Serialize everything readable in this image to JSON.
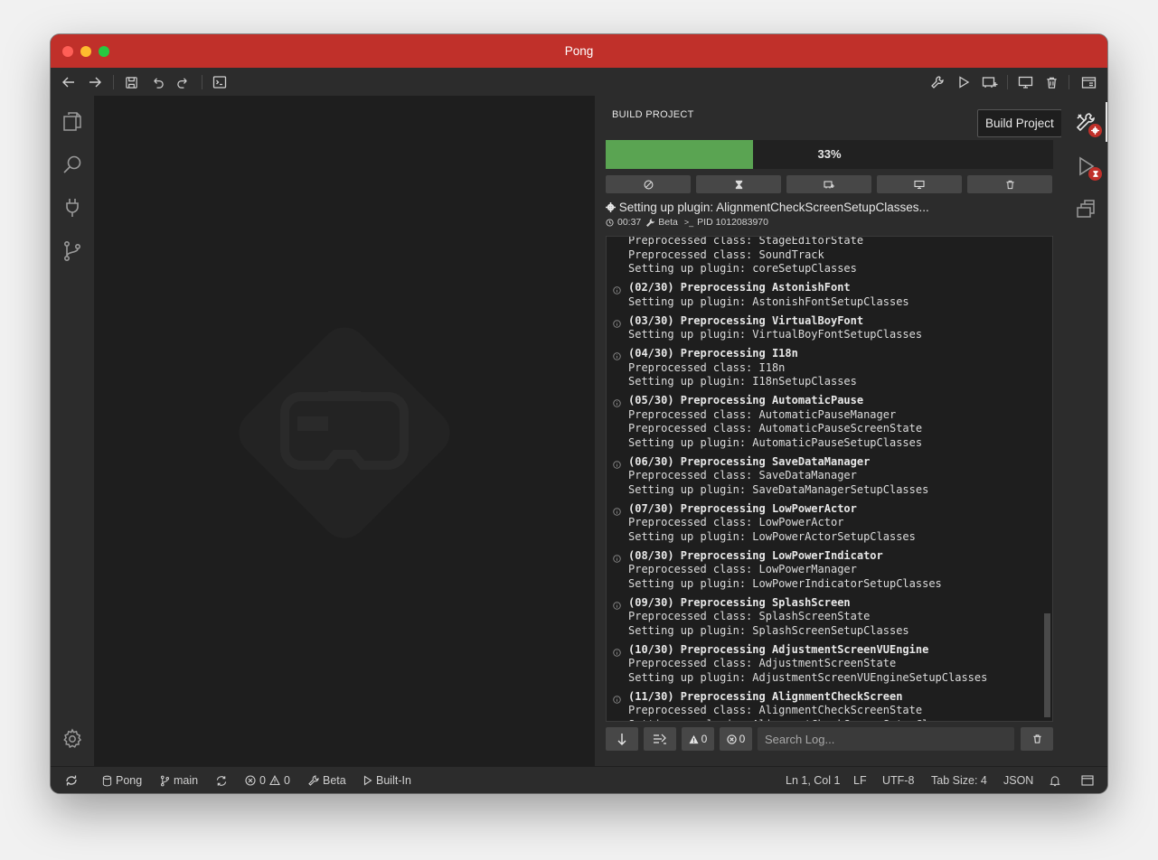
{
  "window": {
    "title": "Pong"
  },
  "panel": {
    "title": "BUILD PROJECT",
    "progress_percent": 33,
    "progress_label": "33%",
    "status_text": "Setting up plugin: AlignmentCheckScreenSetupClasses...",
    "elapsed": "00:37",
    "mode": "Beta",
    "pid": "PID 1012083970"
  },
  "tooltip": "Build Project",
  "log": [
    {
      "text": "Preprocessed class: StageEditorState",
      "bold": false,
      "icon": false
    },
    {
      "text": "Preprocessed class: SoundTrack",
      "bold": false,
      "icon": false
    },
    {
      "text": "Setting up plugin: coreSetupClasses",
      "bold": false,
      "icon": false
    },
    {
      "text": "(02/30) Preprocessing AstonishFont",
      "bold": true,
      "icon": true
    },
    {
      "text": "Setting up plugin: AstonishFontSetupClasses",
      "bold": false,
      "icon": false
    },
    {
      "text": "(03/30) Preprocessing VirtualBoyFont",
      "bold": true,
      "icon": true
    },
    {
      "text": "Setting up plugin: VirtualBoyFontSetupClasses",
      "bold": false,
      "icon": false
    },
    {
      "text": "(04/30) Preprocessing I18n",
      "bold": true,
      "icon": true
    },
    {
      "text": "Preprocessed class: I18n",
      "bold": false,
      "icon": false
    },
    {
      "text": "Setting up plugin: I18nSetupClasses",
      "bold": false,
      "icon": false
    },
    {
      "text": "(05/30) Preprocessing AutomaticPause",
      "bold": true,
      "icon": true
    },
    {
      "text": "Preprocessed class: AutomaticPauseManager",
      "bold": false,
      "icon": false
    },
    {
      "text": "Preprocessed class: AutomaticPauseScreenState",
      "bold": false,
      "icon": false
    },
    {
      "text": "Setting up plugin: AutomaticPauseSetupClasses",
      "bold": false,
      "icon": false
    },
    {
      "text": "(06/30) Preprocessing SaveDataManager",
      "bold": true,
      "icon": true
    },
    {
      "text": "Preprocessed class: SaveDataManager",
      "bold": false,
      "icon": false
    },
    {
      "text": "Setting up plugin: SaveDataManagerSetupClasses",
      "bold": false,
      "icon": false
    },
    {
      "text": "(07/30) Preprocessing LowPowerActor",
      "bold": true,
      "icon": true
    },
    {
      "text": "Preprocessed class: LowPowerActor",
      "bold": false,
      "icon": false
    },
    {
      "text": "Setting up plugin: LowPowerActorSetupClasses",
      "bold": false,
      "icon": false
    },
    {
      "text": "(08/30) Preprocessing LowPowerIndicator",
      "bold": true,
      "icon": true
    },
    {
      "text": "Preprocessed class: LowPowerManager",
      "bold": false,
      "icon": false
    },
    {
      "text": "Setting up plugin: LowPowerIndicatorSetupClasses",
      "bold": false,
      "icon": false
    },
    {
      "text": "(09/30) Preprocessing SplashScreen",
      "bold": true,
      "icon": true
    },
    {
      "text": "Preprocessed class: SplashScreenState",
      "bold": false,
      "icon": false
    },
    {
      "text": "Setting up plugin: SplashScreenSetupClasses",
      "bold": false,
      "icon": false
    },
    {
      "text": "(10/30) Preprocessing AdjustmentScreenVUEngine",
      "bold": true,
      "icon": true
    },
    {
      "text": "Preprocessed class: AdjustmentScreenState",
      "bold": false,
      "icon": false
    },
    {
      "text": "Setting up plugin: AdjustmentScreenVUEngineSetupClasses",
      "bold": false,
      "icon": false
    },
    {
      "text": "(11/30) Preprocessing AlignmentCheckScreen",
      "bold": true,
      "icon": true
    },
    {
      "text": "Preprocessed class: AlignmentCheckScreenState",
      "bold": false,
      "icon": false
    },
    {
      "text": "Setting up plugin: AlignmentCheckScreenSetupClasses",
      "bold": false,
      "icon": false
    }
  ],
  "log_footer": {
    "warnings": "0",
    "errors": "0",
    "search_placeholder": "Search Log..."
  },
  "statusbar": {
    "project": "Pong",
    "branch": "main",
    "errors": "0",
    "warnings": "0",
    "mode": "Beta",
    "emulator": "Built-In",
    "position": "Ln 1, Col 1",
    "eol": "LF",
    "encoding": "UTF-8",
    "tab_size": "Tab Size: 4",
    "language": "JSON"
  },
  "colors": {
    "titlebar": "#c0302a",
    "progress": "#5aa452",
    "badge": "#c0302a"
  }
}
